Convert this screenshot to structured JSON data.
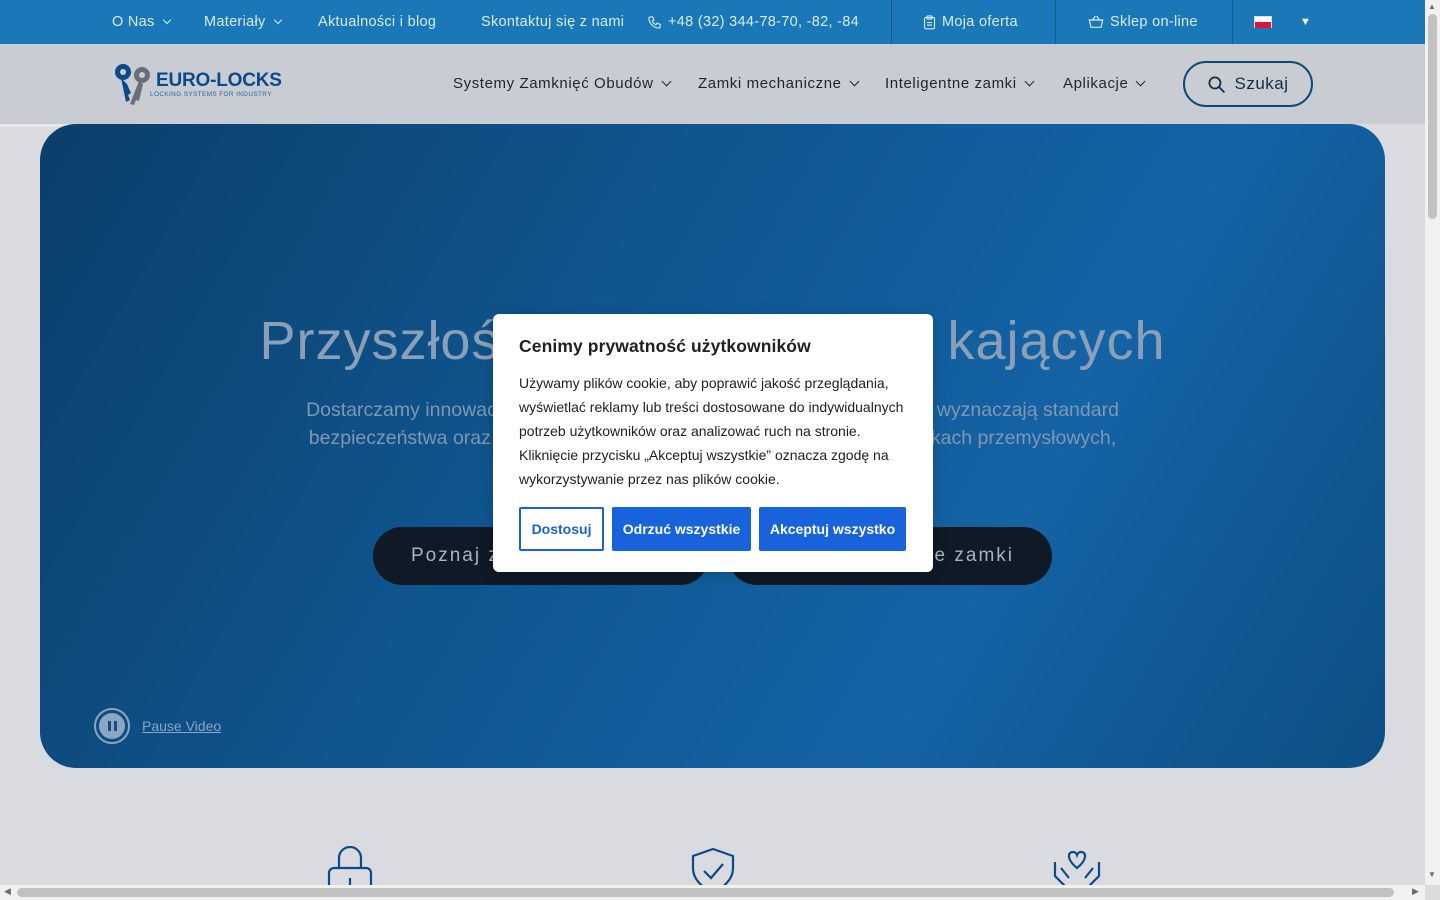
{
  "topbar": {
    "about": "O Nas",
    "materials": "Materiały",
    "news": "Aktualności i blog",
    "contact": "Skontaktuj się z nami",
    "phone": "+48 (32) 344-78-70, -82, -84",
    "offer": "Moja oferta",
    "shop": "Sklep on-line",
    "language_icon": "flag-pl-icon"
  },
  "logo": {
    "name": "EURO-LOCKS",
    "tagline": "LOCKING SYSTEMS FOR INDUSTRY"
  },
  "nav": {
    "items": [
      {
        "label": "Systemy Zamknięć Obudów"
      },
      {
        "label": "Zamki mechaniczne"
      },
      {
        "label": "Inteligentne zamki"
      },
      {
        "label": "Aplikacje"
      }
    ],
    "search_label": "Szukaj"
  },
  "hero": {
    "title_left": "Przyszłoś",
    "title_right": "kających",
    "sub_line1_left": "Dostarczamy innowac",
    "sub_line1_right": "wyznaczają standard",
    "sub_line2_left": "bezpieczeństwa oraz",
    "sub_line2_right": "kach przemysłowych,",
    "btn1_visible": "Poznaj z",
    "btn2_visible": "ne zamki",
    "pause_label": "Pause Video"
  },
  "cookie": {
    "title": "Cenimy prywatność użytkowników",
    "text": "Używamy plików cookie, aby poprawić jakość przeglądania, wyświetlać reklamy lub treści dostosowane do indywidualnych potrzeb użytkowników oraz analizować ruch na stronie. Kliknięcie przycisku „Akceptuj wszystkie” oznacza zgodę na wykorzystywanie przez nas plików cookie.",
    "customize": "Dostosuj",
    "reject": "Odrzuć wszystkie",
    "accept": "Akceptuj wszystko"
  },
  "features": {
    "icons": [
      "lock-icon",
      "shield-check-icon",
      "heart-hands-icon"
    ]
  },
  "colors": {
    "topbar": "#1a78b8",
    "hero": "#0f5690",
    "accent_button": "#1863dc"
  }
}
